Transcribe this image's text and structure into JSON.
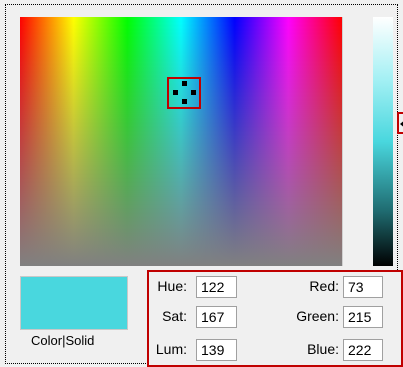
{
  "colors": {
    "selected": "#49d7de",
    "highlight": "#c00000"
  },
  "preview": {
    "label": "Color|Solid"
  },
  "fields": {
    "hue": {
      "label": "Hue:",
      "value": "122"
    },
    "sat": {
      "label": "Sat:",
      "value": "167"
    },
    "lum": {
      "label": "Lum:",
      "value": "139"
    },
    "red": {
      "label": "Red:",
      "value": "73"
    },
    "green": {
      "label": "Green:",
      "value": "215"
    },
    "blue": {
      "label": "Blue:",
      "value": "222"
    }
  }
}
